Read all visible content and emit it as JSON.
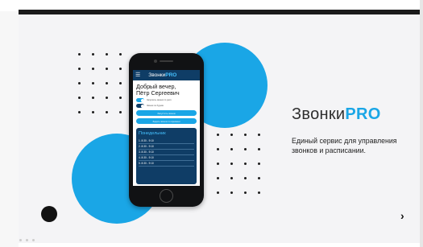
{
  "slide": {
    "logo": {
      "main": "Звонки",
      "accent": "PRO"
    },
    "tagline": "Единый сервис для управления звонков и расписании.",
    "next_arrow": "›",
    "colors": {
      "accent": "#1aa6e6",
      "dark_blue": "#0f3d66",
      "black_dot": "#121212"
    }
  },
  "app": {
    "menu_icon": "☰",
    "brand": {
      "main": "Звонки",
      "accent": "PRO"
    },
    "greeting_line1": "Добрый вечер,",
    "greeting_line2": "Пётр Сергеевич",
    "toggle1_text": "Запускать звонки по расп.",
    "toggle2_text": "Звонки по будням",
    "button1": "Запустить звонок",
    "button2": "Задать звонок по времени",
    "schedule_day": "Понедельник",
    "schedule_items": [
      "1. 8:30 - 9:10",
      "2. 8:30 - 9:10",
      "3. 8:30 - 9:10",
      "4. 8:30 - 9:10",
      "5. 8:30 - 9:10"
    ]
  }
}
